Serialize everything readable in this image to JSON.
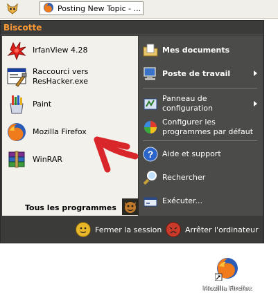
{
  "taskbar": {
    "tab_title": "Posting New Topic - ..."
  },
  "menu": {
    "user_name": "Biscotte",
    "pinned": [
      {
        "label": "IrfanView 4.28",
        "icon": "irfanview-icon"
      },
      {
        "label": "Raccourci vers\nResHacker.exe",
        "icon": "reshacker-icon"
      },
      {
        "label": "Paint",
        "icon": "paint-icon"
      },
      {
        "label": "Mozilla Firefox",
        "icon": "firefox-icon"
      },
      {
        "label": "WinRAR",
        "icon": "winrar-icon"
      }
    ],
    "all_programs": "Tous les programmes",
    "places": [
      {
        "label": "Mes documents",
        "bold": true
      },
      {
        "label": "Poste de travail",
        "bold": true
      },
      {
        "label": "Panneau de\nconfiguration",
        "bold": false
      },
      {
        "label": "Configurer les\nprogrammes par défaut",
        "bold": false
      },
      {
        "label": "Aide et support",
        "bold": false
      },
      {
        "label": "Rechercher",
        "bold": false
      },
      {
        "label": "Exécuter...",
        "bold": false
      }
    ],
    "logoff": "Fermer la session",
    "shutdown": "Arrêter l'ordinateur"
  },
  "desktop": {
    "firefox_label": "Mozilla Firefox"
  },
  "colors": {
    "menu_bg": "#3b3b3a",
    "header_text": "#ff9933",
    "left_pane": "#f2f1ec",
    "right_pane": "#4b4b49",
    "annotation_arrow": "#d9262b"
  }
}
